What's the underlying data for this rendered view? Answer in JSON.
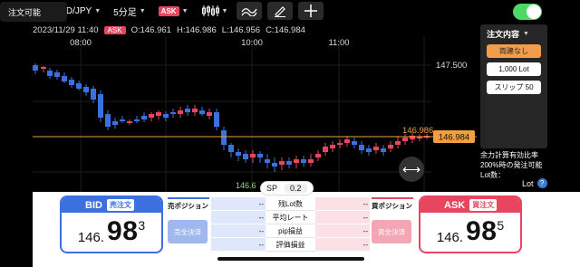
{
  "toolbar": {
    "pair": "USD/JPY",
    "timeframe": "5分足",
    "side_tag": "ASK"
  },
  "info": {
    "datetime": "2023/11/29 11:40",
    "side": "ASK",
    "open": "O:146.961",
    "high": "H:146.986",
    "low": "L:146.956",
    "close": "C:146.984"
  },
  "chart": {
    "time_labels": [
      "08:00",
      "10:00",
      "11:00"
    ],
    "price_labels": [
      "147.500"
    ],
    "current_price_line": "146.986",
    "current_price_badge": "146.984",
    "low_label": "146.6",
    "colors": {
      "up": "#e8455f",
      "down": "#3c6fe0",
      "price_line": "#f0a040"
    }
  },
  "order": {
    "toggle_label": "注文可能",
    "toggle_on": true,
    "title": "注文内容",
    "option_type": "両建なし",
    "lot": "1,000 Lot",
    "slippage": "スリップ 50",
    "calc_line1": "余力計算有効比率",
    "calc_line2": "200%時の発注可能",
    "calc_line3": "Lot数：",
    "lot_label": "Lot",
    "help": "?"
  },
  "spread": {
    "label": "SP",
    "value": "0.2"
  },
  "bid": {
    "label": "BID",
    "action": "売注文",
    "price_small": "146.",
    "price_big": "98",
    "price_sup": "3"
  },
  "ask": {
    "label": "ASK",
    "action": "買注文",
    "price_small": "146.",
    "price_big": "98",
    "price_sup": "5"
  },
  "sell_position": {
    "title": "売ポジション",
    "settle": "売全決済"
  },
  "buy_position": {
    "title": "買ポジション",
    "settle": "買全決済"
  },
  "table": [
    {
      "left": "--",
      "label": "残Lot数",
      "right": "--"
    },
    {
      "left": "--",
      "label": "平均レート",
      "right": "--"
    },
    {
      "left": "--",
      "label": "pip損益",
      "right": "--"
    },
    {
      "left": "--",
      "label": "評価損益",
      "right": "--"
    }
  ]
}
